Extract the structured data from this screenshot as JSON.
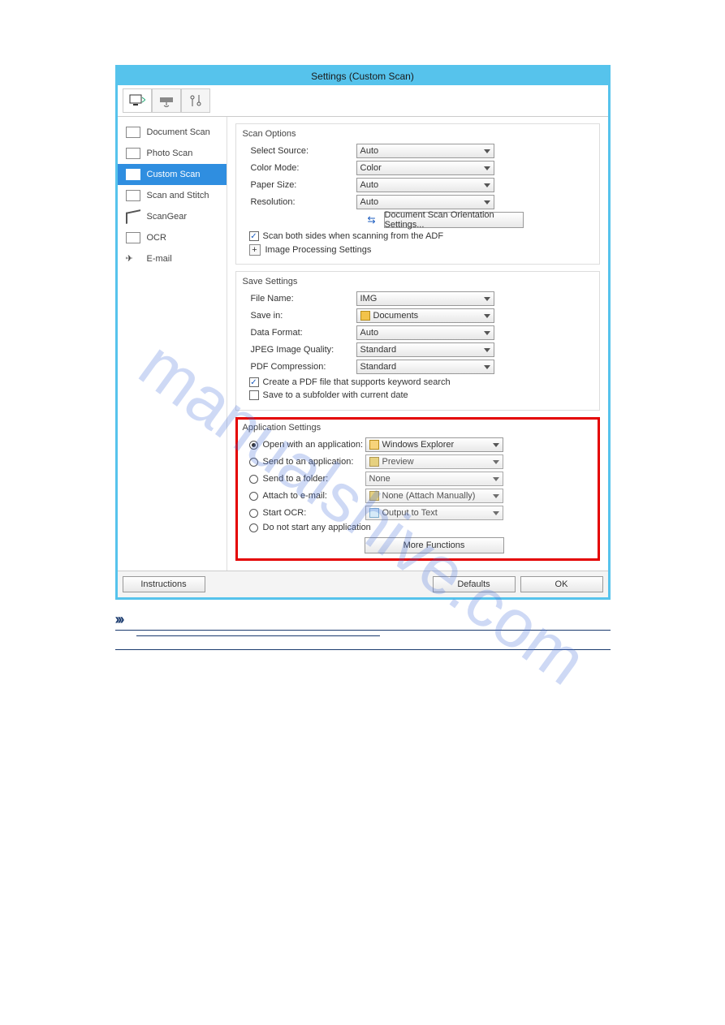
{
  "dialog": {
    "title": "Settings (Custom Scan)"
  },
  "sidebar": {
    "items": [
      {
        "label": "Document Scan"
      },
      {
        "label": "Photo Scan"
      },
      {
        "label": "Custom Scan"
      },
      {
        "label": "Scan and Stitch"
      },
      {
        "label": "ScanGear"
      },
      {
        "label": "OCR"
      },
      {
        "label": "E-mail"
      }
    ]
  },
  "scanOptions": {
    "title": "Scan Options",
    "selectSourceLabel": "Select Source:",
    "selectSourceValue": "Auto",
    "colorModeLabel": "Color Mode:",
    "colorModeValue": "Color",
    "paperSizeLabel": "Paper Size:",
    "paperSizeValue": "Auto",
    "resolutionLabel": "Resolution:",
    "resolutionValue": "Auto",
    "orientationButton": "Document Scan Orientation Settings...",
    "scanBothSidesLabel": "Scan both sides when scanning from the ADF",
    "imageProcessingLabel": "Image Processing Settings"
  },
  "saveSettings": {
    "title": "Save Settings",
    "fileNameLabel": "File Name:",
    "fileNameValue": "IMG",
    "saveInLabel": "Save in:",
    "saveInValue": "Documents",
    "dataFormatLabel": "Data Format:",
    "dataFormatValue": "Auto",
    "jpegQualityLabel": "JPEG Image Quality:",
    "jpegQualityValue": "Standard",
    "pdfCompressionLabel": "PDF Compression:",
    "pdfCompressionValue": "Standard",
    "createPdfKeywordLabel": "Create a PDF file that supports keyword search",
    "saveSubfolderLabel": "Save to a subfolder with current date"
  },
  "appSettings": {
    "title": "Application Settings",
    "openWithLabel": "Open with an application:",
    "openWithValue": "Windows Explorer",
    "sendAppLabel": "Send to an application:",
    "sendAppValue": "Preview",
    "sendFolderLabel": "Send to a folder:",
    "sendFolderValue": "None",
    "attachEmailLabel": "Attach to e-mail:",
    "attachEmailValue": "None (Attach Manually)",
    "startOcrLabel": "Start OCR:",
    "startOcrValue": "Output to Text",
    "doNotStartLabel": "Do not start any application",
    "moreFunctionsLabel": "More Functions"
  },
  "bottom": {
    "instructions": "Instructions",
    "defaults": "Defaults",
    "ok": "OK"
  },
  "watermark": "manualshive.com"
}
